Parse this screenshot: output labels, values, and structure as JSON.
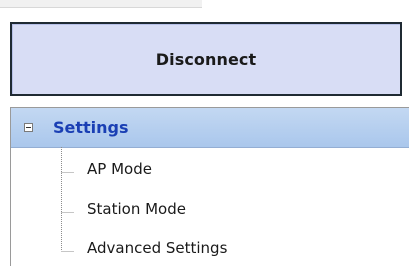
{
  "connection": {
    "disconnect_label": "Disconnect"
  },
  "tree": {
    "header_label": "Settings",
    "expander_state": "expanded",
    "items": [
      {
        "label": "AP Mode"
      },
      {
        "label": "Station Mode"
      },
      {
        "label": "Advanced Settings"
      }
    ]
  },
  "colors": {
    "button_bg": "#d8ddf5",
    "header_bg": "#b6cff0",
    "header_text": "#1a3fb4"
  }
}
